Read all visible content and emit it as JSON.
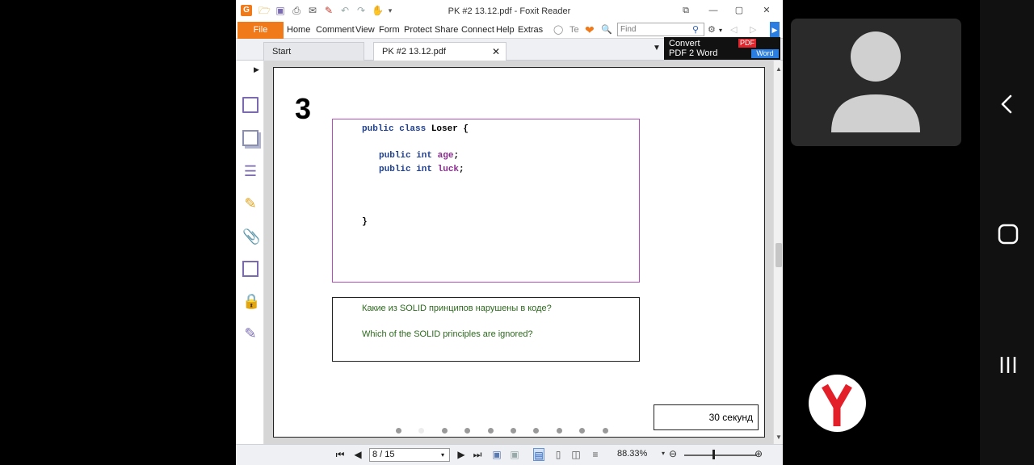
{
  "window": {
    "title": "PK #2 13.12.pdf - Foxit Reader",
    "buttons": [
      "restore-icon",
      "minimize-icon",
      "maximize-icon",
      "close-icon"
    ]
  },
  "ribbon": {
    "file_label": "File",
    "menu": [
      "Home",
      "Comment",
      "View",
      "Form",
      "Protect",
      "Share",
      "Connect",
      "Help",
      "Extras"
    ],
    "tell_label": "Te",
    "find_placeholder": "Find"
  },
  "tabs": [
    {
      "label": "Start"
    },
    {
      "label": "PK #2 13.12.pdf"
    }
  ],
  "convert_banner": {
    "line1": "Convert",
    "line2": "PDF 2 Word",
    "pdf_badge": "PDF",
    "word_badge": "Word"
  },
  "slide": {
    "number": "3",
    "code": {
      "line1_kw": "public class",
      "line1_name": "Loser {",
      "line2_kw": "public int",
      "line2_id": "age",
      "line3_kw": "public int",
      "line3_id": "luck",
      "semicolon": ";",
      "close": "}"
    },
    "question_ru": "Какие из SOLID принципов нарушены в коде?",
    "question_en": "Which of the SOLID principles are ignored?",
    "timer": "30 секунд",
    "dot_count": 10,
    "active_dot": 1
  },
  "statusbar": {
    "page": "8 / 15",
    "zoom": "88.33%",
    "zoom_level": 0.4
  },
  "colors": {
    "file_button": "#f07a1a",
    "code_border": "#b24fb8",
    "keyword": "#1f3f8f",
    "identifier": "#8b2c8f",
    "question_text": "#2a6a1a",
    "yandex_red": "#e3202a"
  }
}
